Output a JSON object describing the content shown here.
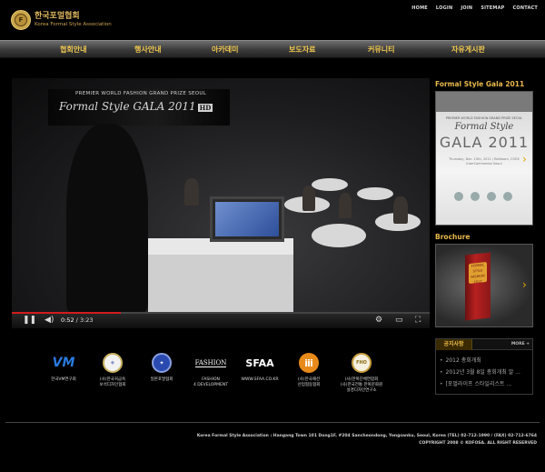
{
  "top_links": [
    "HOME",
    "LOGIN",
    "JOIN",
    "SITEMAP",
    "CONTACT"
  ],
  "logo": {
    "title_kr": "한국포멀협회",
    "title_en": "Korea Formal Style Association"
  },
  "nav": [
    "협회안내",
    "행사안내",
    "아카데미",
    "보도자료",
    "커뮤니티",
    "자유게시판"
  ],
  "video": {
    "overlay_line1": "PREMIER WORLD FASHION GRAND PRIZE SEOUL",
    "overlay_line2": "Formal Style GALA 2011",
    "overlay_badge": "HD",
    "current_time": "0:52",
    "duration": "3:23",
    "time_separator": " / ",
    "progress": 0.26,
    "icons": {
      "play": "pause-icon",
      "volume": "volume-icon",
      "settings": "gear-icon",
      "size": "theater-icon",
      "fullscreen": "fullscreen-icon"
    }
  },
  "sidebar": {
    "gala_title": "Formal Style Gala 2011",
    "gala_thumb": {
      "small": "PREMIER WORLD FASHION GRAND PRIZE SEOUL",
      "title": "Formal Style",
      "gala": "GALA 2011",
      "info": "Thursday, Dec. 15th, 2011 / Ballroom, COEX InterContinental Seoul"
    },
    "brochure_title": "Brochure",
    "brochure_book": "FORMAL STYLE FASHION 2012",
    "notice": {
      "tab": "공지사항",
      "more": "MORE +",
      "items": [
        "2012 총회개최",
        "2012년 3월 8일 총회개최 알 ...",
        "[포멀라이프 스타일리스트 ..."
      ]
    }
  },
  "partners": [
    {
      "mark": "VM",
      "label": "한국VM연구회",
      "color": "#2a7be0"
    },
    {
      "mark": "⚜",
      "label": "(사)한국귀금속\n보석디자인협회",
      "color": "#c8b060"
    },
    {
      "mark": "✦",
      "label": "일본포멀협회",
      "color": "#2a4ab0"
    },
    {
      "mark": "FASHION",
      "label": "FASHION\n4 DEVELOPMENT",
      "color": "#ffffff"
    },
    {
      "mark": "SFAA",
      "label": "WWW.SFAA.CO.KR",
      "color": "#ffffff"
    },
    {
      "mark": "ⅲ",
      "label": "(사)한국패션\n산업협동협회",
      "color": "#e88a1a"
    },
    {
      "mark": "FHO",
      "label": "(사)한복단체연합회\n(사)한국전통 한복문화원\n설경디자인연구소",
      "color": "#c8a040"
    }
  ],
  "footer": {
    "address": "Korea Formal Style Association : Hangang Town 101 Dong1F, #204 Sancheondong, Yongsanku, Seoul, Korea (TEL) 02-712-1990 / (FAX) 02-712-6764",
    "copyright": "COPYRIGHT 2008 © KOFOSA. ALL RIGHT RESERVED"
  }
}
